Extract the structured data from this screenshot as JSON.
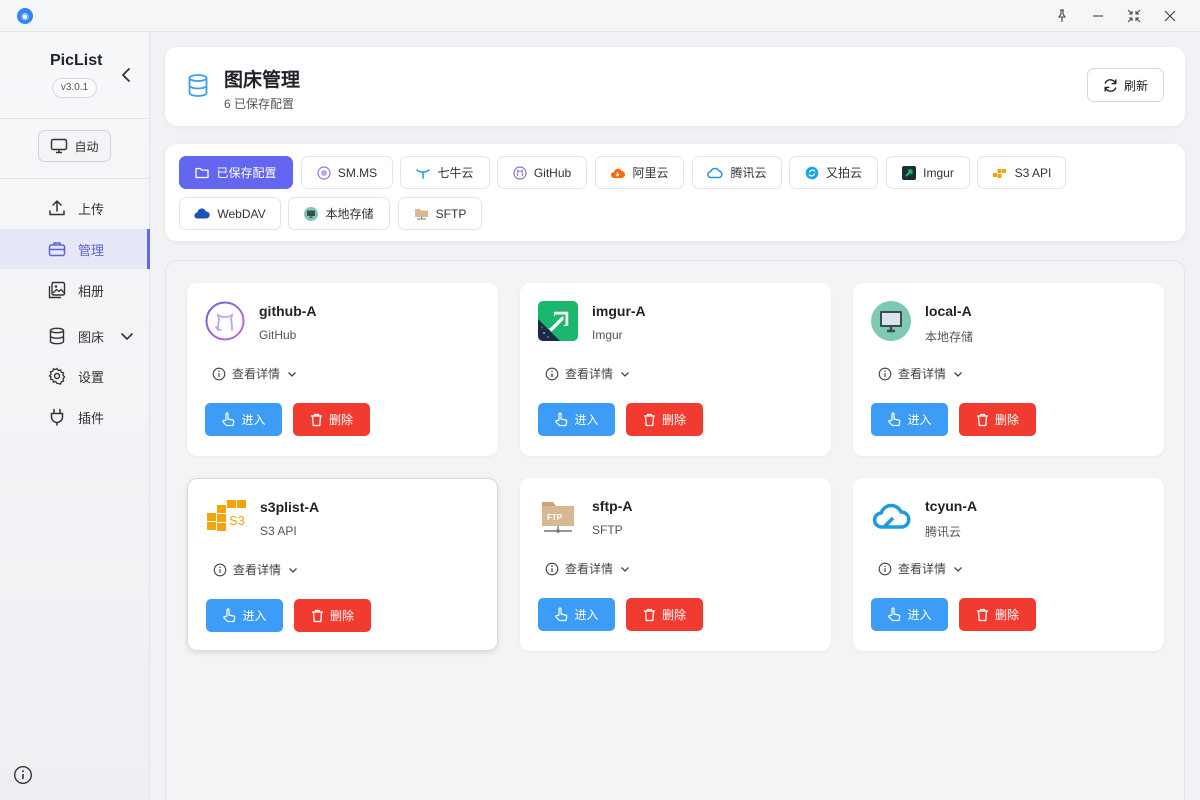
{
  "app": {
    "name": "PicList",
    "version": "v3.0.1"
  },
  "sidebar": {
    "auto_label": "自动",
    "items": [
      {
        "label": "上传",
        "icon": "upload-icon"
      },
      {
        "label": "管理",
        "icon": "briefcase-icon"
      },
      {
        "label": "相册",
        "icon": "gallery-icon"
      },
      {
        "label": "图床",
        "icon": "database-icon"
      },
      {
        "label": "设置",
        "icon": "gear-icon"
      },
      {
        "label": "插件",
        "icon": "plug-icon"
      }
    ],
    "active_index": 1
  },
  "header": {
    "title": "图床管理",
    "subtitle": "6 已保存配置",
    "refresh_label": "刷新"
  },
  "tabs": [
    {
      "label": "已保存配置",
      "icon": "folder-icon"
    },
    {
      "label": "SM.MS",
      "icon": "smms-icon"
    },
    {
      "label": "七牛云",
      "icon": "qiniu-icon"
    },
    {
      "label": "GitHub",
      "icon": "github-icon"
    },
    {
      "label": "阿里云",
      "icon": "aliyun-icon"
    },
    {
      "label": "腾讯云",
      "icon": "tencent-cloud-icon"
    },
    {
      "label": "又拍云",
      "icon": "upyun-icon"
    },
    {
      "label": "Imgur",
      "icon": "imgur-icon"
    },
    {
      "label": "S3 API",
      "icon": "s3-icon"
    },
    {
      "label": "WebDAV",
      "icon": "webdav-icon"
    },
    {
      "label": "本地存储",
      "icon": "local-storage-icon"
    },
    {
      "label": "SFTP",
      "icon": "sftp-icon"
    }
  ],
  "cards": [
    {
      "name": "github-A",
      "type": "GitHub",
      "logo": "github-logo"
    },
    {
      "name": "imgur-A",
      "type": "Imgur",
      "logo": "imgur-logo"
    },
    {
      "name": "local-A",
      "type": "本地存储",
      "logo": "local-storage-logo"
    },
    {
      "name": "s3plist-A",
      "type": "S3 API",
      "logo": "s3-logo"
    },
    {
      "name": "sftp-A",
      "type": "SFTP",
      "logo": "sftp-logo"
    },
    {
      "name": "tcyun-A",
      "type": "腾讯云",
      "logo": "tencent-cloud-logo"
    }
  ],
  "card_actions": {
    "detail_label": "查看详情",
    "enter_label": "进入",
    "delete_label": "删除"
  },
  "colors": {
    "accent": "#6366f1",
    "enter_button": "#3d9cf5",
    "delete_button": "#f23b30"
  }
}
